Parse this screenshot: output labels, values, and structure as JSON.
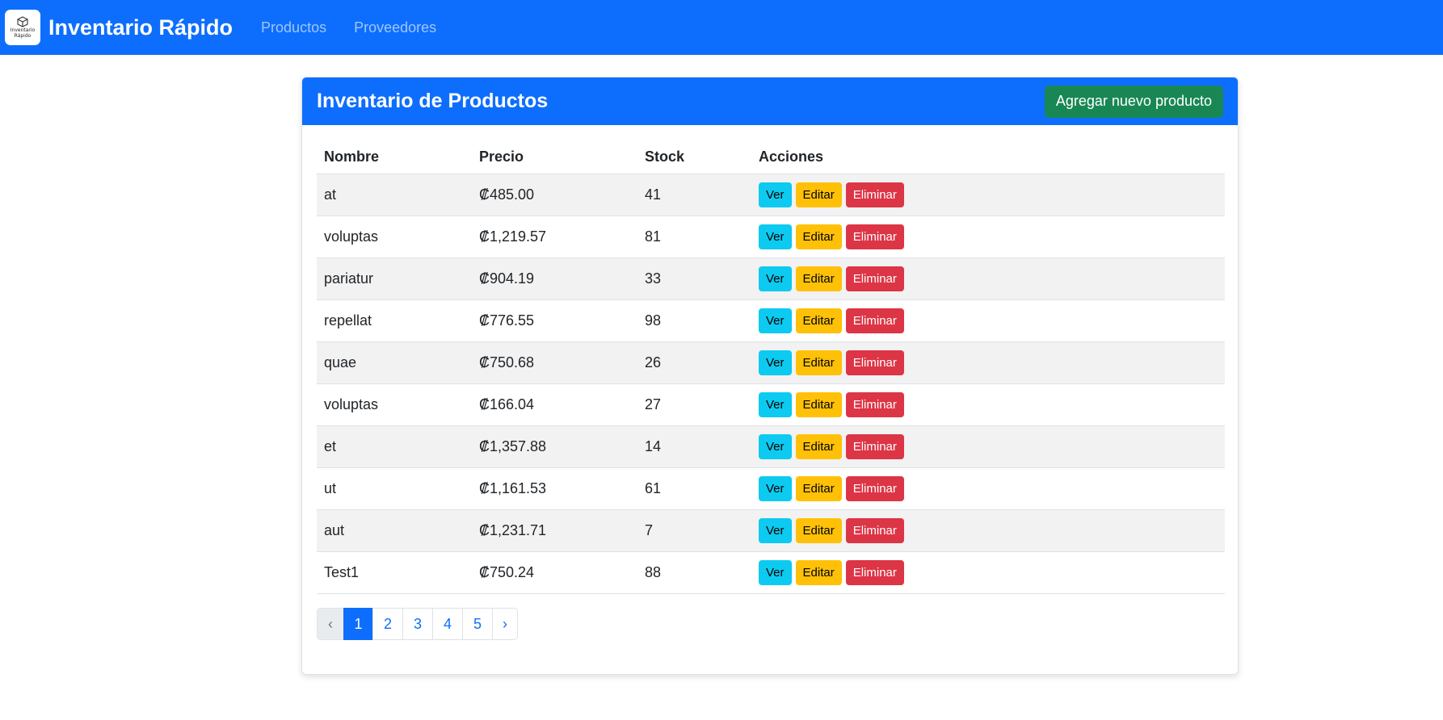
{
  "app": {
    "brand_name": "Inventario Rápido",
    "logo_text_line1": "Inventario",
    "logo_text_line2": "Rápido",
    "nav": [
      {
        "label": "Productos"
      },
      {
        "label": "Proveedores"
      }
    ]
  },
  "card": {
    "title": "Inventario de Productos",
    "add_button_label": "Agregar nuevo producto"
  },
  "table": {
    "headers": [
      "Nombre",
      "Precio",
      "Stock",
      "Acciones"
    ],
    "action_labels": {
      "view": "Ver",
      "edit": "Editar",
      "delete": "Eliminar"
    },
    "rows": [
      {
        "nombre": "at",
        "precio": "₡485.00",
        "stock": "41"
      },
      {
        "nombre": "voluptas",
        "precio": "₡1,219.57",
        "stock": "81"
      },
      {
        "nombre": "pariatur",
        "precio": "₡904.19",
        "stock": "33"
      },
      {
        "nombre": "repellat",
        "precio": "₡776.55",
        "stock": "98"
      },
      {
        "nombre": "quae",
        "precio": "₡750.68",
        "stock": "26"
      },
      {
        "nombre": "voluptas",
        "precio": "₡166.04",
        "stock": "27"
      },
      {
        "nombre": "et",
        "precio": "₡1,357.88",
        "stock": "14"
      },
      {
        "nombre": "ut",
        "precio": "₡1,161.53",
        "stock": "61"
      },
      {
        "nombre": "aut",
        "precio": "₡1,231.71",
        "stock": "7"
      },
      {
        "nombre": "Test1",
        "precio": "₡750.24",
        "stock": "88"
      }
    ]
  },
  "pagination": {
    "prev": "‹",
    "next": "›",
    "pages": [
      "1",
      "2",
      "3",
      "4",
      "5"
    ],
    "active_page": "1"
  },
  "colors": {
    "primary": "#0d6efd",
    "success": "#198754",
    "info": "#0dcaf0",
    "warning": "#ffc107",
    "danger": "#dc3545"
  }
}
